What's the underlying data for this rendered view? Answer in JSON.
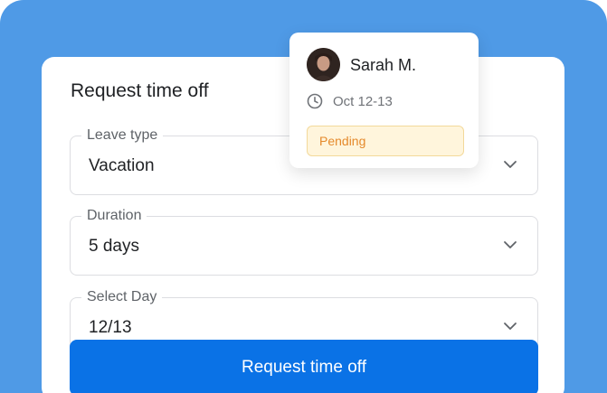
{
  "form": {
    "title": "Request time off",
    "fields": [
      {
        "label": "Leave type",
        "value": "Vacation"
      },
      {
        "label": "Duration",
        "value": "5 days"
      },
      {
        "label": "Select Day",
        "value": "12/13"
      }
    ],
    "submit_label": "Request time off"
  },
  "popover": {
    "user_name": "Sarah M.",
    "dates": "Oct 12-13",
    "status": "Pending"
  },
  "colors": {
    "background": "#4f9ae6",
    "button": "#0a72e6",
    "badge_bg": "#fff5dc",
    "badge_text": "#e58a2c"
  },
  "icons": {
    "dropdown": "chevron-down-icon",
    "time": "clock-icon"
  }
}
